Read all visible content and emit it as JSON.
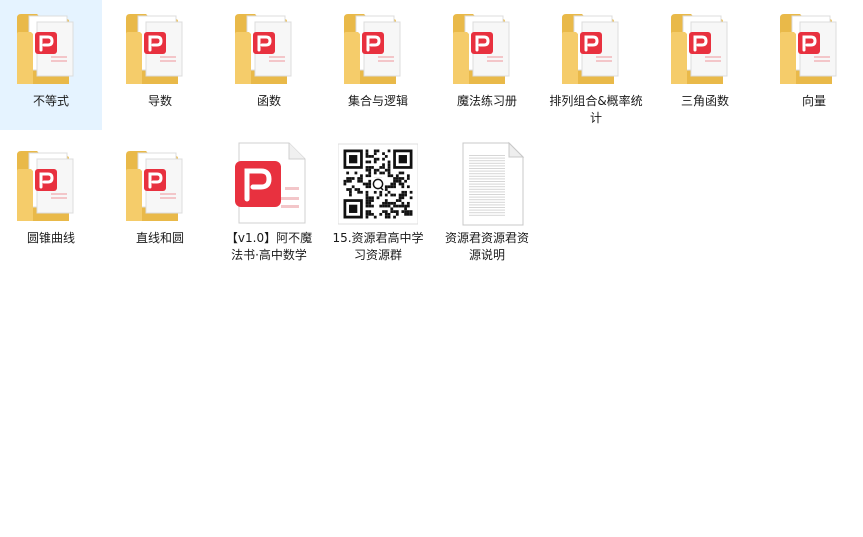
{
  "items": [
    {
      "label": "不等式",
      "kind": "folder",
      "icon": "folder-with-wps-pdf-icon",
      "selected": true
    },
    {
      "label": "导数",
      "kind": "folder",
      "icon": "folder-with-wps-pdf-icon"
    },
    {
      "label": "函数",
      "kind": "folder",
      "icon": "folder-with-wps-pdf-icon"
    },
    {
      "label": "集合与逻辑",
      "kind": "folder",
      "icon": "folder-with-wps-pdf-icon"
    },
    {
      "label": "魔法练习册",
      "kind": "folder",
      "icon": "folder-with-wps-pdf-icon"
    },
    {
      "label": "排列组合&概率统计",
      "kind": "folder",
      "icon": "folder-with-wps-pdf-icon"
    },
    {
      "label": "三角函数",
      "kind": "folder",
      "icon": "folder-with-wps-pdf-icon"
    },
    {
      "label": "向量",
      "kind": "folder",
      "icon": "folder-with-wps-pdf-icon"
    },
    {
      "label": "圆锥曲线",
      "kind": "folder",
      "icon": "folder-with-wps-pdf-icon"
    },
    {
      "label": "直线和圆",
      "kind": "folder",
      "icon": "folder-with-wps-pdf-icon"
    },
    {
      "label": "【v1.0】阿不魔法书·高中数学",
      "kind": "pdf",
      "icon": "wps-pdf-file-icon"
    },
    {
      "label": "15.资源君高中学习资源群",
      "kind": "qr",
      "icon": "qr-code-image-icon"
    },
    {
      "label": "资源君资源君资源说明",
      "kind": "txt",
      "icon": "text-document-icon"
    }
  ],
  "colors": {
    "selection": "#e5f3ff",
    "folder": "#f5cc6a",
    "pdf_red": "#e8313f"
  }
}
